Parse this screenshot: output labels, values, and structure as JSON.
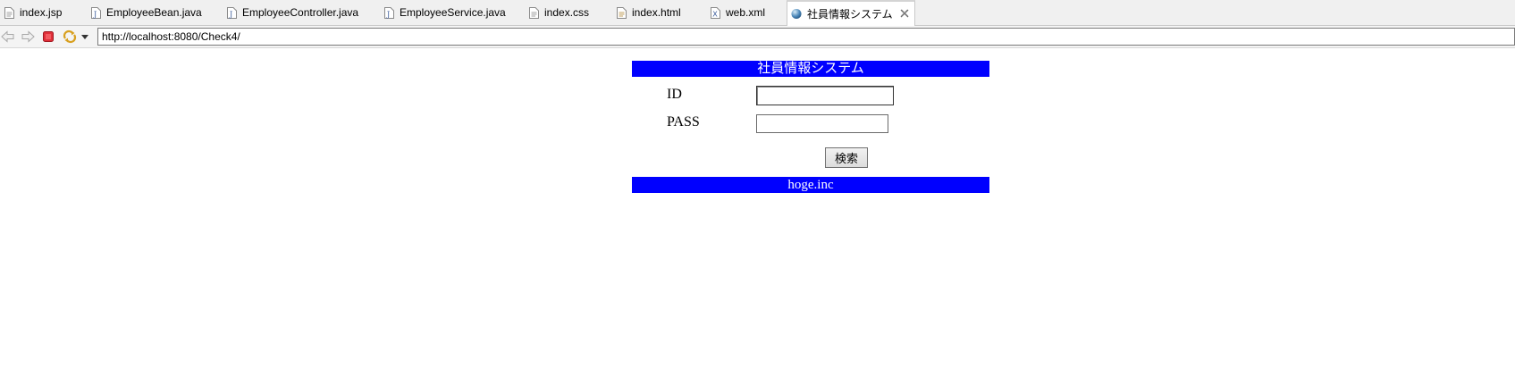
{
  "tabs": [
    {
      "label": "index.jsp",
      "icon": "jsp-file-icon"
    },
    {
      "label": "EmployeeBean.java",
      "icon": "java-file-icon"
    },
    {
      "label": "EmployeeController.java",
      "icon": "java-file-icon"
    },
    {
      "label": "EmployeeService.java",
      "icon": "java-file-icon"
    },
    {
      "label": "index.css",
      "icon": "css-file-icon"
    },
    {
      "label": "index.html",
      "icon": "html-file-icon"
    },
    {
      "label": "web.xml",
      "icon": "xml-file-icon"
    },
    {
      "label": "社員情報システム",
      "icon": "globe-icon"
    }
  ],
  "browser": {
    "url": "http://localhost:8080/Check4/"
  },
  "page": {
    "header_title": "社員情報システム",
    "id_label": "ID",
    "id_value": "",
    "pass_label": "PASS",
    "pass_value": "",
    "search_button": "検索",
    "footer_text": "hoge.inc"
  },
  "colors": {
    "bar_blue": "#0000ff",
    "bar_text": "#ffffff"
  }
}
